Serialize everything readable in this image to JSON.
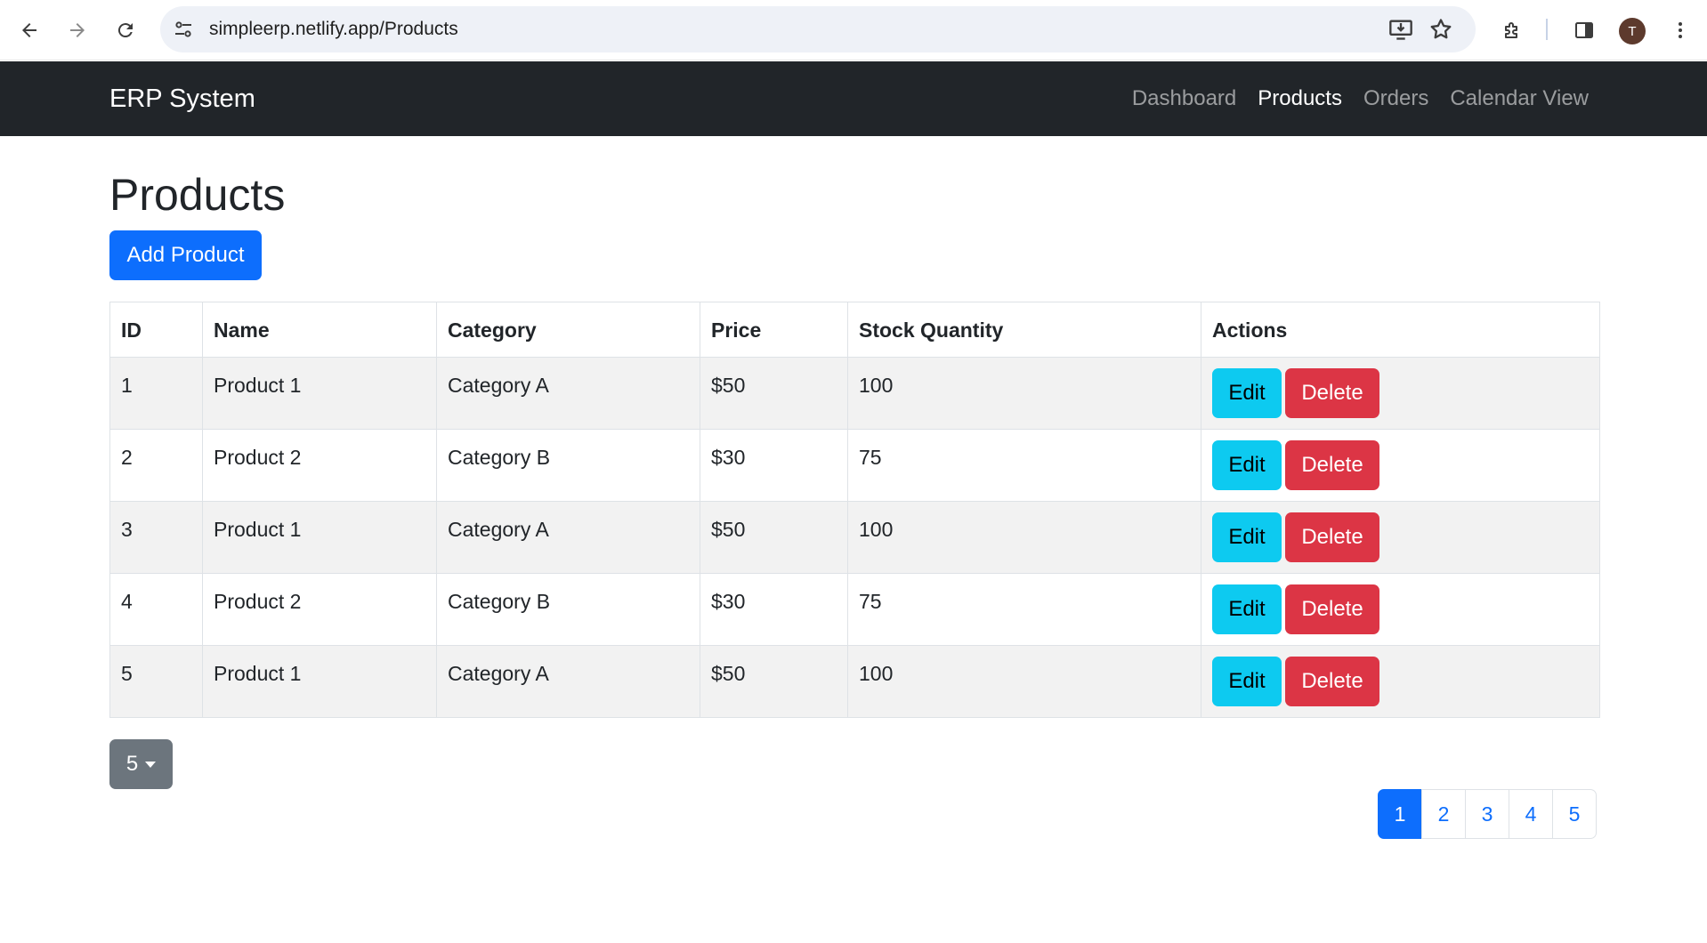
{
  "browser": {
    "url": "simpleerp.netlify.app/Products",
    "profile_initial": "T"
  },
  "navbar": {
    "brand": "ERP System",
    "links": [
      {
        "label": "Dashboard"
      },
      {
        "label": "Products"
      },
      {
        "label": "Orders"
      },
      {
        "label": "Calendar View"
      }
    ],
    "active": "Products"
  },
  "main": {
    "title": "Products",
    "add_button": "Add Product"
  },
  "table": {
    "headers": [
      "ID",
      "Name",
      "Category",
      "Price",
      "Stock Quantity",
      "Actions"
    ],
    "rows": [
      {
        "id": "1",
        "name": "Product 1",
        "category": "Category A",
        "price": "$50",
        "stock": "100"
      },
      {
        "id": "2",
        "name": "Product 2",
        "category": "Category B",
        "price": "$30",
        "stock": "75"
      },
      {
        "id": "3",
        "name": "Product 1",
        "category": "Category A",
        "price": "$50",
        "stock": "100"
      },
      {
        "id": "4",
        "name": "Product 2",
        "category": "Category B",
        "price": "$30",
        "stock": "75"
      },
      {
        "id": "5",
        "name": "Product 1",
        "category": "Category A",
        "price": "$50",
        "stock": "100"
      }
    ],
    "edit_label": "Edit",
    "delete_label": "Delete"
  },
  "page_size": {
    "selected": "5"
  },
  "pagination": {
    "pages": [
      "1",
      "2",
      "3",
      "4",
      "5"
    ],
    "current": "1"
  },
  "colors": {
    "navbar": "#212529",
    "primary": "#0d6efd",
    "info": "#0dcaf0",
    "danger": "#dc3545",
    "secondary": "#6c757d"
  }
}
